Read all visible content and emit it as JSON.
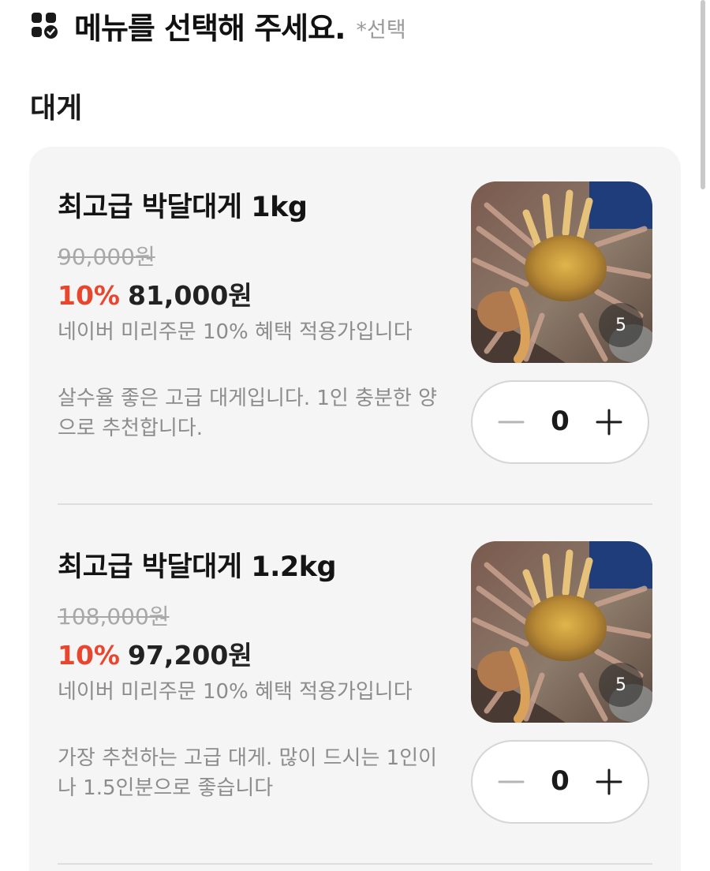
{
  "header": {
    "icon": "menu-check-icon",
    "title": "메뉴를 선택해 주세요.",
    "note": "*선택"
  },
  "section": {
    "title": "대게"
  },
  "items": [
    {
      "name": "최고급 박달대게 1kg",
      "original_price": "90,000원",
      "discount": "10%",
      "sale_price": "81,000원",
      "benefit": "네이버 미리주문 10% 혜택 적용가입니다",
      "description": "살수율 좋은 고급 대게입니다. 1인 충분한 양으로 추천합니다.",
      "image_count": "5",
      "quantity": "0"
    },
    {
      "name": "최고급 박달대게 1.2kg",
      "original_price": "108,000원",
      "discount": "10%",
      "sale_price": "97,200원",
      "benefit": "네이버 미리주문 10% 혜택 적용가입니다",
      "description": "가장 추천하는 고급 대게. 많이 드시는 1인이나 1.5인분으로 좋습니다",
      "image_count": "5",
      "quantity": "0"
    }
  ],
  "colors": {
    "discount": "#e8472f",
    "card_bg": "#f5f5f5"
  }
}
